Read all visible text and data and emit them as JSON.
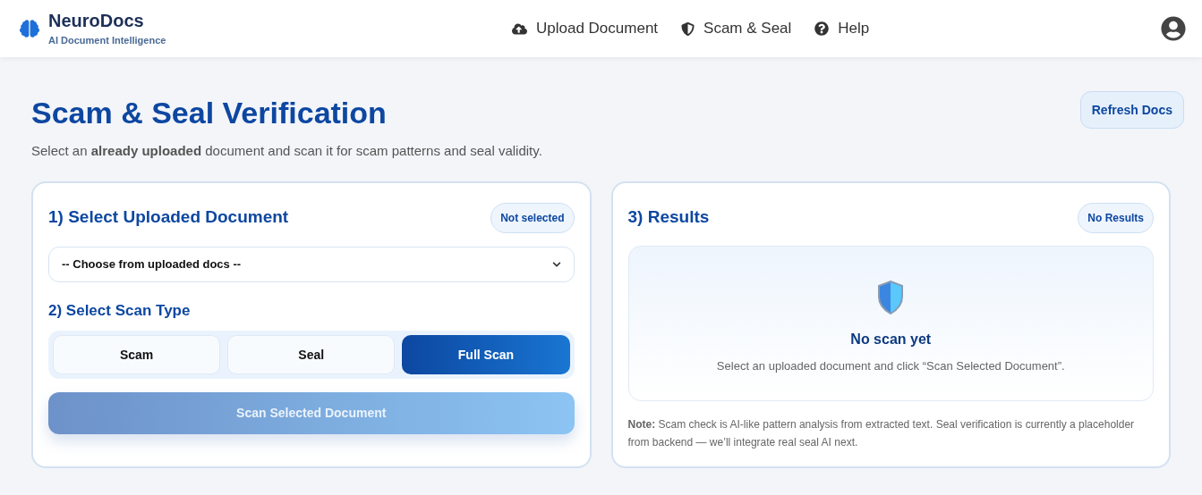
{
  "brand": {
    "name": "NeuroDocs",
    "tagline": "AI Document Intelligence"
  },
  "nav": [
    {
      "kind": "upload",
      "label": "Upload Document"
    },
    {
      "kind": "shield",
      "label": "Scam & Seal"
    },
    {
      "kind": "help",
      "label": "Help"
    }
  ],
  "page": {
    "title": "Scam & Seal Verification",
    "subtitle": "Select an **already uploaded** document and scan it for scam patterns and seal validity.",
    "refresh_button": "Refresh Docs"
  },
  "select_panel": {
    "heading": "1) Select Uploaded Document",
    "badge": "Not selected",
    "dropdown": {
      "value": "-- Choose from uploaded docs --"
    },
    "scan_type_heading": "2) Select Scan Type",
    "scan_types": [
      {
        "label": "Scam",
        "selected": false
      },
      {
        "label": "Seal",
        "selected": false
      },
      {
        "label": "Full Scan",
        "selected": true
      }
    ],
    "scan_button": {
      "label": "Scan Selected Document",
      "disabled": true
    }
  },
  "results_panel": {
    "heading": "3) Results",
    "badge": "No Results",
    "empty_title": "No scan yet",
    "empty_text": "Select an uploaded document and click “Scan Selected Document”.",
    "note": "**Note:** Scam check is AI-like pattern analysis from extracted text. Seal verification is currently a placeholder from backend — we’ll integrate real seal AI next."
  }
}
